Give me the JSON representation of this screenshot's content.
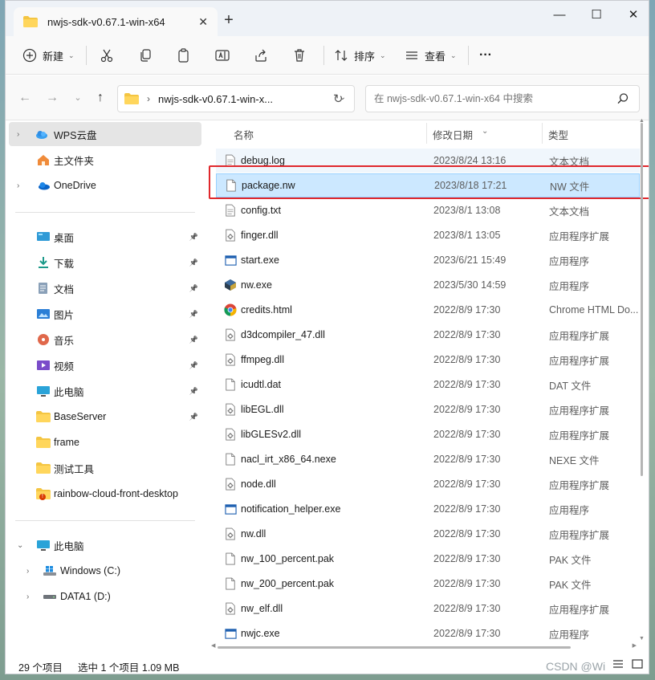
{
  "window": {
    "tab_title": "nwjs-sdk-v0.67.1-win-x64",
    "tab_close": "✕",
    "new_tab": "+",
    "minimize": "—",
    "maximize": "☐",
    "close": "✕"
  },
  "toolbar": {
    "new_label": "新建",
    "sort_label": "排序",
    "view_label": "查看",
    "more": "···"
  },
  "address": {
    "path": "nwjs-sdk-v0.67.1-win-x...",
    "search_placeholder": "在 nwjs-sdk-v0.67.1-win-x64 中搜索"
  },
  "sidebar": {
    "top": [
      {
        "label": "WPS云盘",
        "icon": "cloud-icon"
      },
      {
        "label": "主文件夹",
        "icon": "home-icon"
      },
      {
        "label": "OneDrive",
        "icon": "onedrive-icon"
      }
    ],
    "quick": [
      {
        "label": "桌面",
        "icon": "desktop-icon"
      },
      {
        "label": "下载",
        "icon": "download-icon"
      },
      {
        "label": "文档",
        "icon": "document-icon"
      },
      {
        "label": "图片",
        "icon": "pictures-icon"
      },
      {
        "label": "音乐",
        "icon": "music-icon"
      },
      {
        "label": "视频",
        "icon": "video-icon"
      },
      {
        "label": "此电脑",
        "icon": "computer-icon"
      },
      {
        "label": "BaseServer",
        "icon": "folder-icon"
      },
      {
        "label": "frame",
        "icon": "folder-icon"
      },
      {
        "label": "测试工具",
        "icon": "folder-icon"
      },
      {
        "label": "rainbow-cloud-front-desktop",
        "icon": "folder-icon"
      }
    ],
    "pc": [
      {
        "label": "此电脑",
        "icon": "computer-icon"
      },
      {
        "label": "Windows (C:)",
        "icon": "drive-icon"
      },
      {
        "label": "DATA1 (D:)",
        "icon": "drive-icon"
      }
    ]
  },
  "columns": {
    "name": "名称",
    "date": "修改日期",
    "type": "类型"
  },
  "files": [
    {
      "name": "debug.log",
      "date": "2023/8/24 13:16",
      "type": "文本文档",
      "icon": "text-file-icon"
    },
    {
      "name": "package.nw",
      "date": "2023/8/18 17:21",
      "type": "NW 文件",
      "icon": "blank-file-icon"
    },
    {
      "name": "config.txt",
      "date": "2023/8/1 13:08",
      "type": "文本文档",
      "icon": "text-file-icon"
    },
    {
      "name": "finger.dll",
      "date": "2023/8/1 13:05",
      "type": "应用程序扩展",
      "icon": "dll-file-icon"
    },
    {
      "name": "start.exe",
      "date": "2023/6/21 15:49",
      "type": "应用程序",
      "icon": "exe-file-icon"
    },
    {
      "name": "nw.exe",
      "date": "2023/5/30 14:59",
      "type": "应用程序",
      "icon": "nwjs-app-icon"
    },
    {
      "name": "credits.html",
      "date": "2022/8/9 17:30",
      "type": "Chrome HTML Do...",
      "icon": "chrome-icon"
    },
    {
      "name": "d3dcompiler_47.dll",
      "date": "2022/8/9 17:30",
      "type": "应用程序扩展",
      "icon": "dll-file-icon"
    },
    {
      "name": "ffmpeg.dll",
      "date": "2022/8/9 17:30",
      "type": "应用程序扩展",
      "icon": "dll-file-icon"
    },
    {
      "name": "icudtl.dat",
      "date": "2022/8/9 17:30",
      "type": "DAT 文件",
      "icon": "blank-file-icon"
    },
    {
      "name": "libEGL.dll",
      "date": "2022/8/9 17:30",
      "type": "应用程序扩展",
      "icon": "dll-file-icon"
    },
    {
      "name": "libGLESv2.dll",
      "date": "2022/8/9 17:30",
      "type": "应用程序扩展",
      "icon": "dll-file-icon"
    },
    {
      "name": "nacl_irt_x86_64.nexe",
      "date": "2022/8/9 17:30",
      "type": "NEXE 文件",
      "icon": "blank-file-icon"
    },
    {
      "name": "node.dll",
      "date": "2022/8/9 17:30",
      "type": "应用程序扩展",
      "icon": "dll-file-icon"
    },
    {
      "name": "notification_helper.exe",
      "date": "2022/8/9 17:30",
      "type": "应用程序",
      "icon": "exe-file-icon"
    },
    {
      "name": "nw.dll",
      "date": "2022/8/9 17:30",
      "type": "应用程序扩展",
      "icon": "dll-file-icon"
    },
    {
      "name": "nw_100_percent.pak",
      "date": "2022/8/9 17:30",
      "type": "PAK 文件",
      "icon": "blank-file-icon"
    },
    {
      "name": "nw_200_percent.pak",
      "date": "2022/8/9 17:30",
      "type": "PAK 文件",
      "icon": "blank-file-icon"
    },
    {
      "name": "nw_elf.dll",
      "date": "2022/8/9 17:30",
      "type": "应用程序扩展",
      "icon": "dll-file-icon"
    },
    {
      "name": "nwjc.exe",
      "date": "2022/8/9 17:30",
      "type": "应用程序",
      "icon": "exe-file-icon"
    }
  ],
  "selected_index": 1,
  "status": {
    "count": "29 个项目",
    "selection": "选中 1 个项目  1.09 MB"
  },
  "watermark": "CSDN @Wi",
  "colors": {
    "accent": "#0067c0",
    "selection": "#cce8ff",
    "highlight_border": "#e0282d",
    "folder": "#f4c542"
  }
}
